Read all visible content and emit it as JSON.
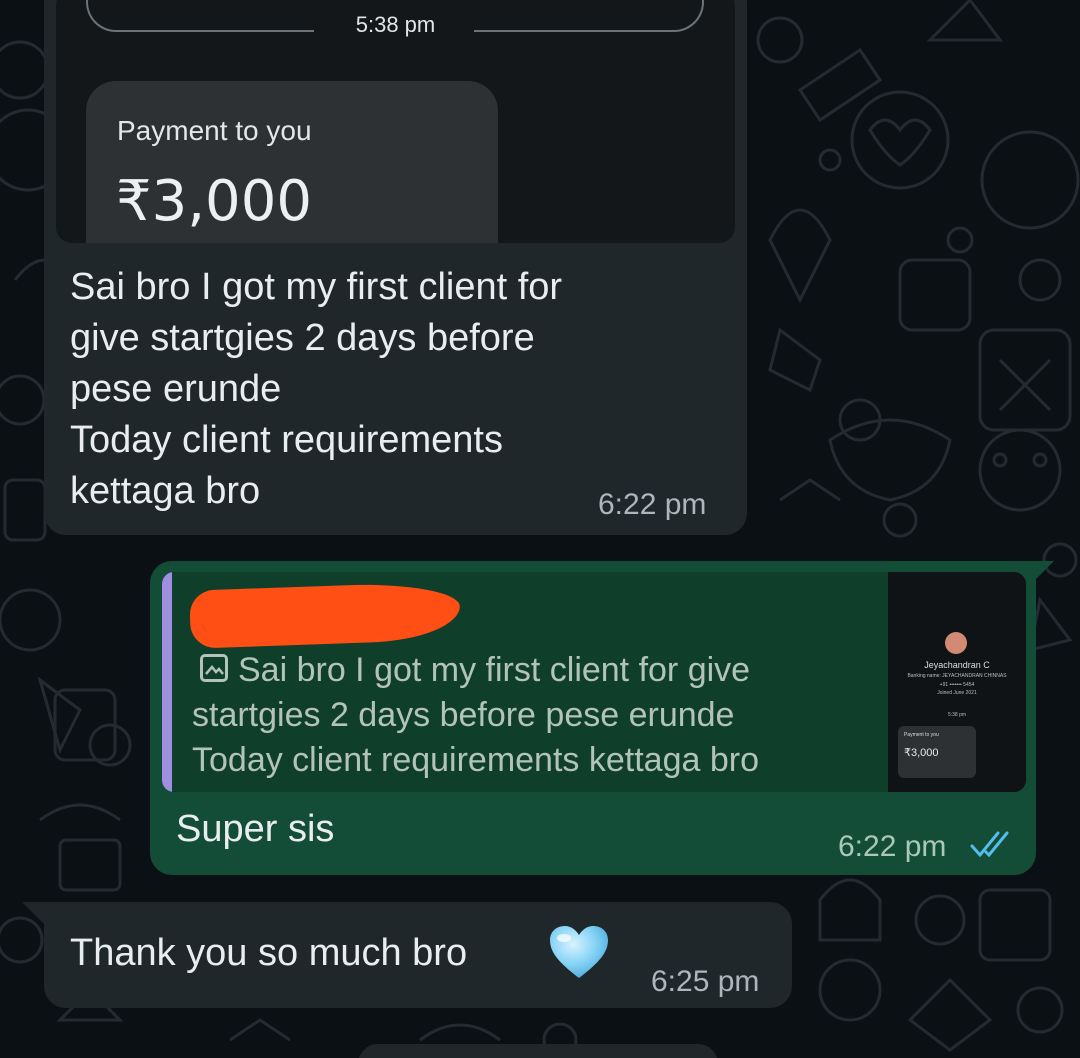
{
  "messages": {
    "incoming_1": {
      "image": {
        "time": "5:38 pm",
        "card_label": "Payment to you",
        "card_amount": "₹3,000"
      },
      "text": "Sai bro I got my first client for\ngive startgies 2 days before\npese erunde\nToday client requirements\nkettaga bro",
      "time": "6:22 pm"
    },
    "outgoing": {
      "quote": {
        "icon": "photo-icon",
        "text": "Sai bro I got my first client for give\nstartgies 2 days before pese erunde\nToday client requirements kettaga bro",
        "thumbnail": {
          "name": "Jeyachandran C",
          "banking_name": "Banking name: JEYACHANDRAN CHINNAS",
          "phone": "+91 ••••••• 5454",
          "joined": "Joined June 2021",
          "time": "5:38 pm",
          "card_label": "Payment to you",
          "card_amount": "₹3,000"
        }
      },
      "text": "Super sis",
      "time": "6:22 pm",
      "status_icon": "double-check-read-icon"
    },
    "incoming_2": {
      "text": "Thank you so much bro",
      "emoji": "light-blue-heart",
      "time": "6:25 pm"
    }
  },
  "colors": {
    "background": "#0b1014",
    "incoming_bubble": "#1f272b",
    "outgoing_bubble": "#144d37",
    "quote_bar": "#a08fe0",
    "read_ticks": "#53bdeb",
    "redaction": "#ff4f14"
  }
}
